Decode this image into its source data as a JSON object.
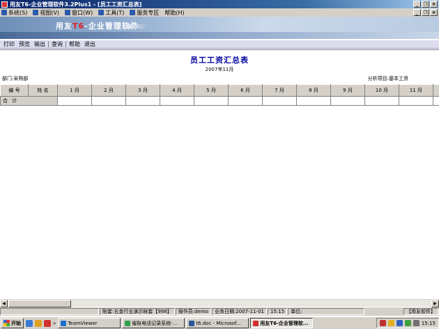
{
  "window": {
    "title": "用友T6-企业管理软件3.2Plus1  - [员工工资汇总表]",
    "buttons": [
      "_",
      "❐",
      "×"
    ]
  },
  "menubar": {
    "items": [
      "系统(S)",
      "视图(V)",
      "窗口(W)",
      "工具(T)",
      "服务专区",
      "帮助(H)"
    ],
    "mdi_buttons": [
      "_",
      "❐",
      "×"
    ]
  },
  "banner": {
    "logo_prefix": "用友",
    "logo_t6": "T6",
    "logo_suffix": "-企业管理软件"
  },
  "toolbar": {
    "items": [
      "打印",
      "预览",
      "输出",
      "查询",
      "帮助",
      "退出"
    ]
  },
  "report": {
    "title": "员工工资汇总表",
    "period": "2007年11月",
    "department": "部门:采购部",
    "analysis_item": "分析项目:基本工资",
    "columns": [
      "编 号",
      "姓 名",
      "1 月",
      "2 月",
      "3 月",
      "4 月",
      "5 月",
      "6 月",
      "7 月",
      "8 月",
      "9 月",
      "10 月",
      "11 月"
    ],
    "total_label": "合 计"
  },
  "statusbar": {
    "account": "账套:五金行业演示帐套【998】",
    "operator": "操作员:demo",
    "business_date": "业务日期:2007-11-01",
    "time": "15:15",
    "unit": "单位:",
    "vendor": "【用友软件】"
  },
  "taskbar": {
    "start_label": "开始",
    "tasks": [
      "TeamViewer",
      "催账电话记录系统-...",
      "t6.doc - Microsof...",
      "用友T6-企业管理软..."
    ],
    "clock": "15:15"
  }
}
